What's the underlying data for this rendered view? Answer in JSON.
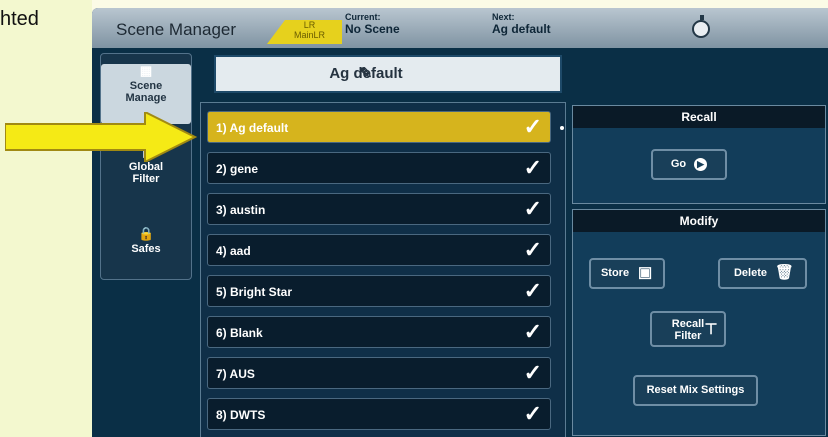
{
  "background_text": "hted",
  "header": {
    "title": "Scene Manager",
    "mix_badge": [
      "LR",
      "MainLR"
    ],
    "current_label": "Current:",
    "current_value": "No Scene",
    "next_label": "Next:",
    "next_value": "Ag default"
  },
  "sidebar": {
    "items": [
      {
        "label_line1": "Scene",
        "label_line2": "Manage",
        "icon": "scene-grid-icon",
        "active": true
      },
      {
        "label_line1": "Global",
        "label_line2": "Filter",
        "icon": "filter-icon"
      },
      {
        "label_line1": "Safes",
        "label_line2": "",
        "icon": "lock-icon"
      }
    ]
  },
  "scene_name": "Ag default",
  "scenes": [
    "1) Ag default",
    "2) gene",
    "3) austin",
    "4) aad",
    "5) Bright Star",
    "6) Blank",
    "7) AUS",
    "8) DWTS"
  ],
  "recall": {
    "title": "Recall",
    "go_label": "Go"
  },
  "modify": {
    "title": "Modify",
    "store_label": "Store",
    "delete_label": "Delete",
    "recall_filter_label": [
      "Recall",
      "Filter"
    ],
    "reset_label": "Reset Mix Settings"
  },
  "colors": {
    "selected_row": "#d6b41d",
    "screen_background": "#0a2f46",
    "arrow": "#f5ea15"
  }
}
